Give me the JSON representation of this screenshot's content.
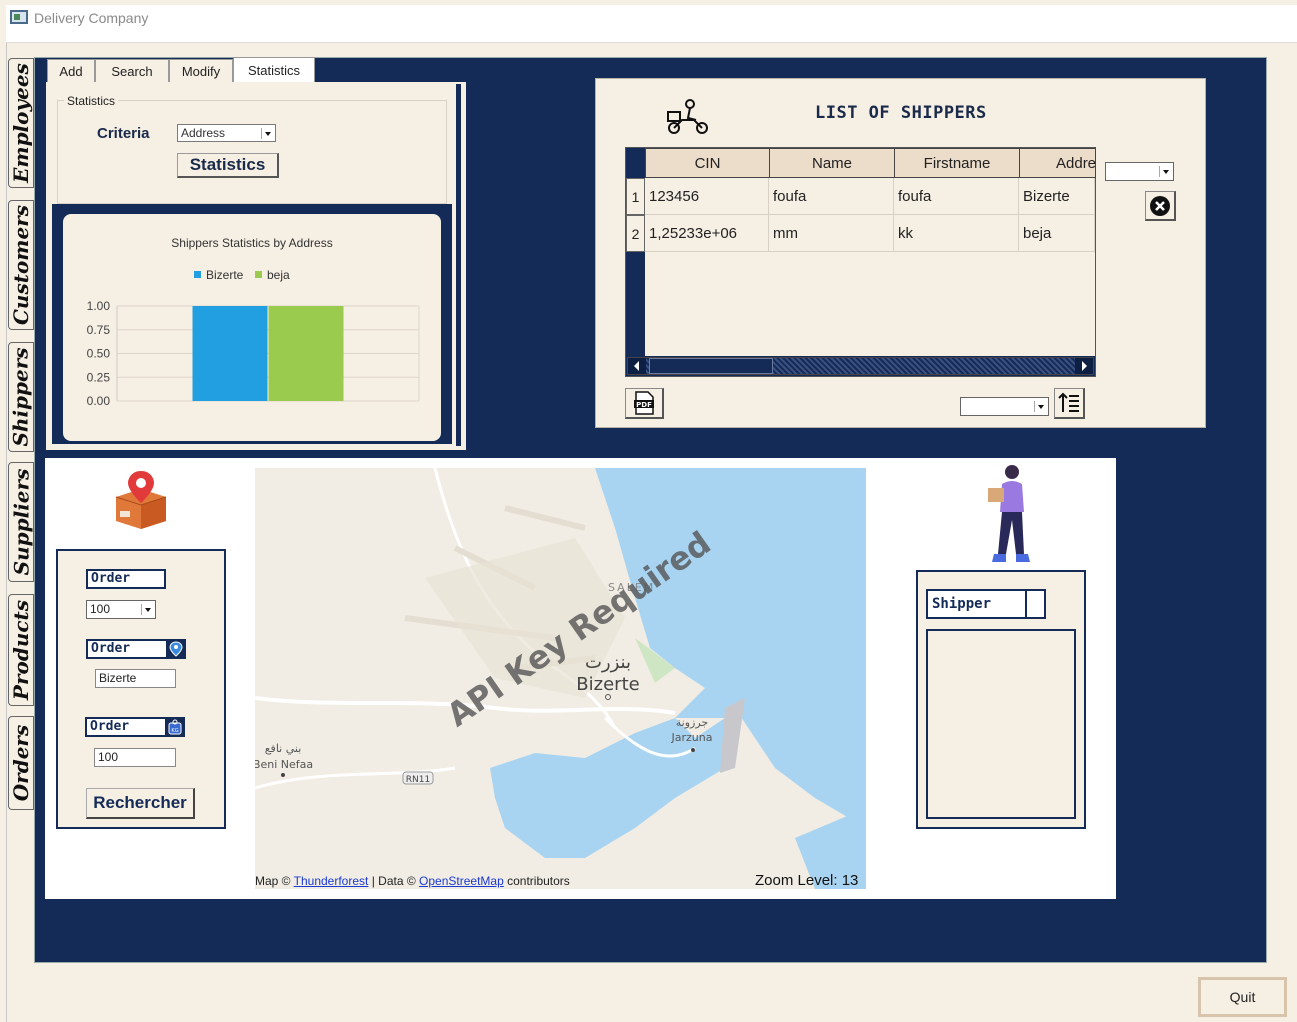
{
  "window": {
    "title": "Delivery Company"
  },
  "side_tabs": [
    "Employees",
    "Customers",
    "Shippers",
    "Suppliers",
    "Products",
    "Orders"
  ],
  "top_tabs": [
    "Add",
    "Search",
    "Modify",
    "Statistics"
  ],
  "statistics": {
    "group_label": "Statistics",
    "criteria_label": "Criteria",
    "criteria_value": "Address",
    "button_label": "Statistics"
  },
  "chart_data": {
    "type": "bar",
    "title": "Shippers Statistics by Address",
    "series": [
      {
        "name": "Bizerte",
        "values": [
          1
        ],
        "color": "#229fe0"
      },
      {
        "name": "beja",
        "values": [
          1
        ],
        "color": "#9acb4e"
      }
    ],
    "yticks": [
      "1.00",
      "0.75",
      "0.50",
      "0.25",
      "0.00"
    ],
    "ylim": [
      0,
      1
    ],
    "legend": "top"
  },
  "shippers": {
    "title": "LIST OF SHIPPERS",
    "columns": [
      "CIN",
      "Name",
      "Firstname",
      "Addre"
    ],
    "rows": [
      {
        "num": "1",
        "cells": [
          "123456",
          "foufa",
          "foufa",
          "Bizerte"
        ]
      },
      {
        "num": "2",
        "cells": [
          "1,25233e+06",
          "mm",
          "kk",
          "beja"
        ]
      }
    ],
    "pdf_label": "PDF"
  },
  "order_form": {
    "order_label_1": "Order",
    "order_select_value": "100",
    "order_label_2": "Order",
    "address_value": "Bizerte",
    "order_label_3": "Order",
    "weight_value": "100",
    "search_button": "Rechercher",
    "weight_badge": "KG"
  },
  "map": {
    "watermark": "API Key Required",
    "labels": {
      "city_ar": "بنزرت",
      "city": "Bizerte",
      "salem": "SALEM",
      "jarzuna_ar": "جرزونة",
      "jarzuna": "Jarzuna",
      "beni_nafaa_ar": "بني نافع",
      "beni_nafaa": "Beni Nefaa",
      "road": "RN11"
    },
    "attribution": {
      "map_prefix": "Map ©",
      "map_link": "Thunderforest",
      "sep": "| Data ©",
      "data_link": "OpenStreetMap",
      "suffix": "contributors"
    },
    "zoom_text": "Zoom Level: 13"
  },
  "shipper_panel": {
    "label": "Shipper"
  },
  "footer": {
    "quit_label": "Quit"
  }
}
